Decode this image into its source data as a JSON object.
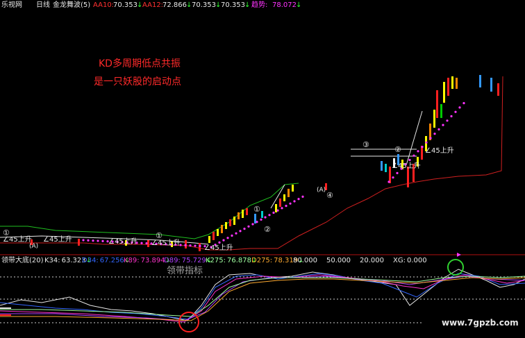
{
  "header": {
    "app_name": "乐视网",
    "period": "日线",
    "indicator_name": "金龙舞波(5)",
    "items": [
      {
        "label": "AA10:",
        "value": "70.353",
        "arrow": "↓"
      },
      {
        "label": "AA12:",
        "value": "72.866",
        "arrow": "↓"
      },
      {
        "label": "",
        "value": "70.353",
        "arrow": "↓"
      },
      {
        "label": "",
        "value": "70.353",
        "arrow": "↓"
      },
      {
        "label": "趋势:",
        "value": "78.072",
        "arrow": "↓"
      }
    ]
  },
  "annotations": {
    "line1": "KD多周期低点共振",
    "line2": "是一只妖股的启动点",
    "subpanel_caption": "领带指标"
  },
  "signals": {
    "rise": "∠45上升",
    "circled": [
      "①",
      "②",
      "③",
      "④"
    ],
    "a_label": "(A)"
  },
  "sub_panel": {
    "title": "领带大底(20)",
    "items": [
      {
        "label": "K34:",
        "value": "63.323",
        "arrow": "↓"
      },
      {
        "label": "D34:",
        "value": "67.256",
        "arrow": "↓"
      },
      {
        "label": "K89:",
        "value": "73.894",
        "arrow": "↓"
      },
      {
        "label": "D89:",
        "value": "75.729",
        "arrow": "↓"
      },
      {
        "label": "K275:",
        "value": "76.878",
        "arrow": "↓"
      },
      {
        "label": "D275:",
        "value": "78.319",
        "arrow": "↓"
      },
      {
        "label": "",
        "value": "80.000",
        "arrow": ""
      },
      {
        "label": "",
        "value": "50.000",
        "arrow": ""
      },
      {
        "label": "",
        "value": "20.000",
        "arrow": ""
      },
      {
        "label": "XG:",
        "value": "0.000",
        "arrow": ""
      }
    ]
  },
  "watermark": "www.7gpzb.com",
  "colors": {
    "background": "#000000",
    "red_text": "#ff2a2a",
    "magenta_dots": "#ff33ff",
    "support_line": "#d02020",
    "green_line": "#20c020",
    "white": "#e8e8e8",
    "circle_red": "#ff2020",
    "circle_green": "#30d030"
  }
}
